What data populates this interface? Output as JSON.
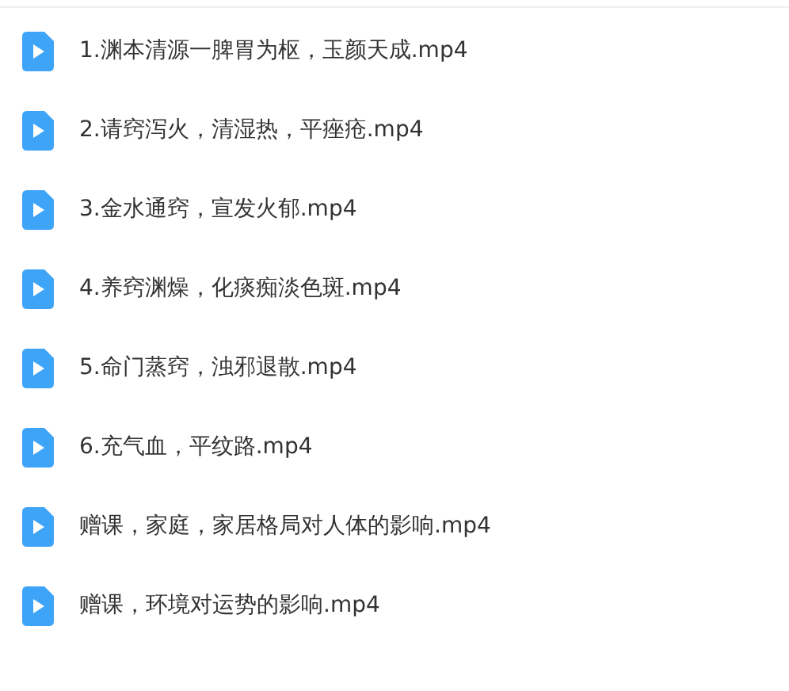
{
  "files": [
    {
      "name": "1.渊本清源一脾胃为枢，玉颜天成.mp4"
    },
    {
      "name": "2.请窍泻火，清湿热，平痤疮.mp4"
    },
    {
      "name": "3.金水通窍，宣发火郁.mp4"
    },
    {
      "name": "4.养窍渊燥，化痰痴淡色斑.mp4"
    },
    {
      "name": "5.命门蒸窍，浊邪退散.mp4"
    },
    {
      "name": "6.充气血，平纹路.mp4"
    },
    {
      "name": "赠课，家庭，家居格局对人体的影响.mp4"
    },
    {
      "name": "赠课，环境对运势的影响.mp4"
    }
  ]
}
